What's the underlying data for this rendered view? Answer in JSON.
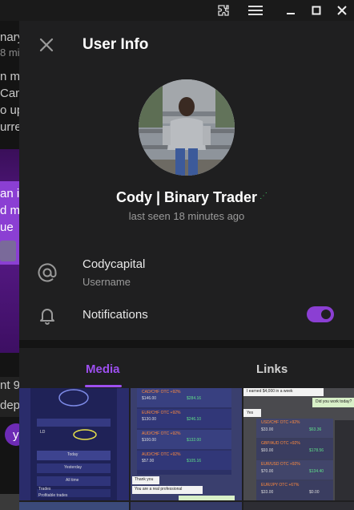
{
  "background_chat": {
    "fragments": [
      "nary",
      "8 mi",
      "n m",
      "Can",
      "o up",
      "urre",
      "an i",
      "d m",
      "ue",
      "nt 9",
      "dep",
      "y"
    ]
  },
  "window": {
    "controls": [
      "extensions-icon",
      "menu-icon",
      "minimize-icon",
      "maximize-icon",
      "close-icon"
    ]
  },
  "header": {
    "title": "User Info"
  },
  "profile": {
    "name": "Cody | Binary Trader",
    "status": "last seen 18 minutes ago"
  },
  "info": {
    "username": "Codycapital",
    "username_label": "Username",
    "notifications_label": "Notifications",
    "notifications_on": true
  },
  "tabs": [
    {
      "label": "Media",
      "active": true
    },
    {
      "label": "Links",
      "active": false
    }
  ],
  "media": {
    "tiles": [
      {
        "name": "media-tile-1",
        "texts": [
          "LD",
          "Today",
          "Yesterday",
          "All time",
          "Trades",
          "Profitable trades"
        ]
      },
      {
        "name": "media-tile-2",
        "texts": [
          "CAD/CHF OTC +92%",
          "$146.00",
          "$284.16",
          "EUR/CHF OTC +92%",
          "$130.00",
          "$246.10",
          "AUD/CHF OTC +92%",
          "$100.00",
          "$132.00",
          "AUD/CHF OTC +92%",
          "$57.00",
          "$105.16",
          "Thank you",
          "You are a real professional"
        ]
      },
      {
        "name": "media-tile-3",
        "texts": [
          "I earned $4,000 in a week",
          "Did you work today?",
          "Yes",
          "USD/CHF OTC +92%",
          "$33.00",
          "$63.36",
          "GBP/AUD OTC +92%",
          "$93.00",
          "$178.56",
          "EUR/USD OTC +92%",
          "$70.00",
          "$134.40",
          "EUR/JPY OTC +67%",
          "$33.00",
          "$0.00"
        ]
      }
    ]
  },
  "colors": {
    "accent": "#9d4ff0",
    "toggle": "#8b3fd3",
    "panel": "#1f1f20",
    "online_dots": "#3fbf5f"
  }
}
